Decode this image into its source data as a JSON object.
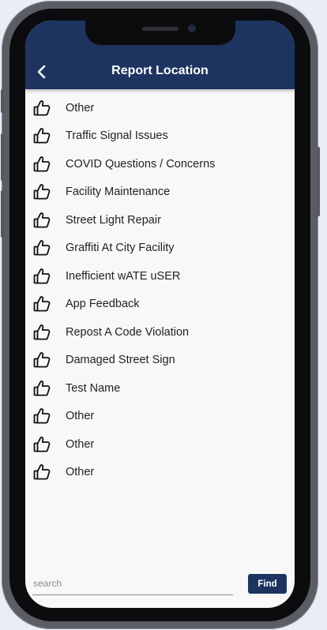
{
  "header": {
    "title": "Report Location",
    "back_icon": "chevron-left-icon"
  },
  "items": [
    {
      "label": "Other",
      "icon": "thumbs-up-icon"
    },
    {
      "label": "Traffic Signal Issues",
      "icon": "thumbs-up-icon"
    },
    {
      "label": "COVID Questions / Concerns",
      "icon": "thumbs-up-icon"
    },
    {
      "label": "Facility Maintenance",
      "icon": "thumbs-up-icon"
    },
    {
      "label": "Street Light Repair",
      "icon": "thumbs-up-icon"
    },
    {
      "label": "Graffiti At City Facility",
      "icon": "thumbs-up-icon"
    },
    {
      "label": "Inefficient wATE uSER",
      "icon": "thumbs-up-icon"
    },
    {
      "label": "App Feedback",
      "icon": "thumbs-up-icon"
    },
    {
      "label": "Repost A Code Violation",
      "icon": "thumbs-up-icon"
    },
    {
      "label": "Damaged Street Sign",
      "icon": "thumbs-up-icon"
    },
    {
      "label": "Test Name",
      "icon": "thumbs-up-icon"
    },
    {
      "label": "Other",
      "icon": "thumbs-up-icon"
    },
    {
      "label": "Other",
      "icon": "thumbs-up-icon"
    },
    {
      "label": "Other",
      "icon": "thumbs-up-icon"
    }
  ],
  "search": {
    "value": "",
    "placeholder": "search",
    "button_label": "Find"
  },
  "colors": {
    "header": "#1d3461",
    "button": "#1d3461",
    "background": "#f8f8f8"
  }
}
